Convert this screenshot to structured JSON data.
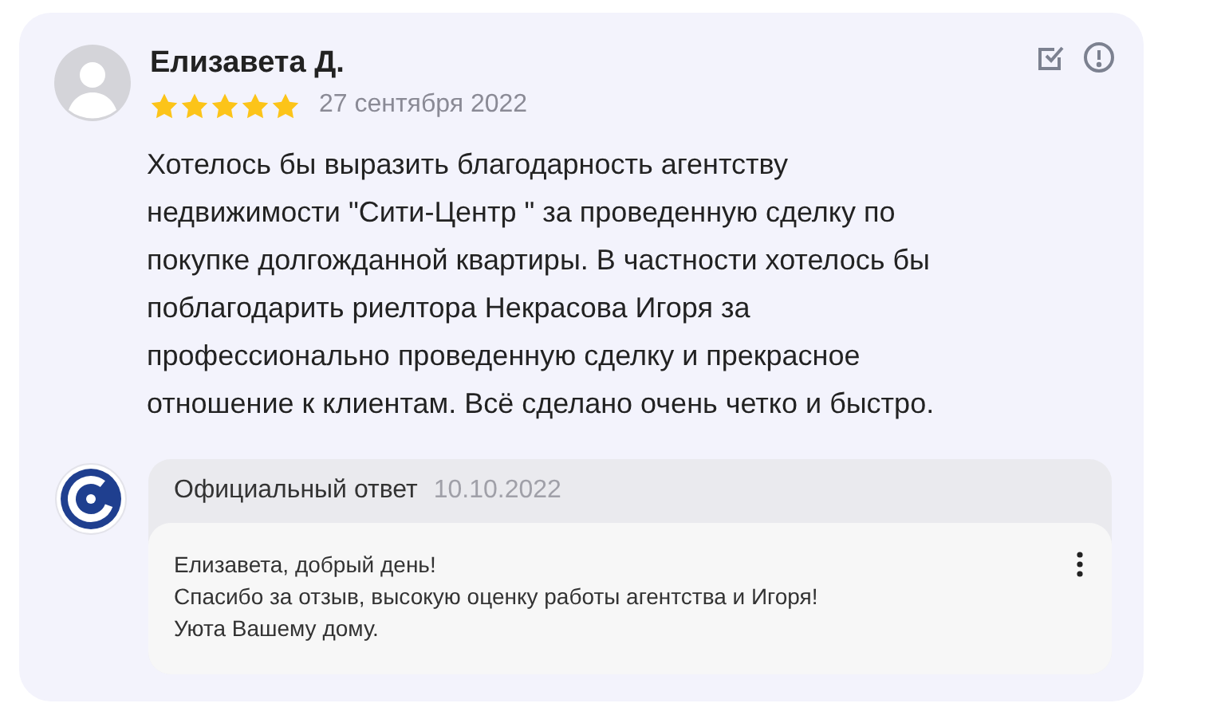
{
  "review": {
    "author": "Елизавета Д.",
    "stars": 5,
    "date": "27 сентября 2022",
    "text_lines": [
      "Хотелось бы выразить благодарность агентству",
      "недвижимости \"Сити-Центр \" за проведенную сделку по",
      "покупке долгожданной квартиры. В частности хотелось бы",
      "поблагодарить риелтора Некрасова Игоря за",
      "профессионально проведенную сделку и прекрасное",
      "отношение к клиентам. Всё сделано очень четко и быстро."
    ]
  },
  "official_reply": {
    "label": "Официальный ответ",
    "date": "10.10.2022",
    "text_lines": [
      "Елизавета, добрый день!",
      "Спасибо за отзыв, высокую оценку работы агентства и Игоря!",
      "Уюта Вашему дому."
    ]
  }
}
